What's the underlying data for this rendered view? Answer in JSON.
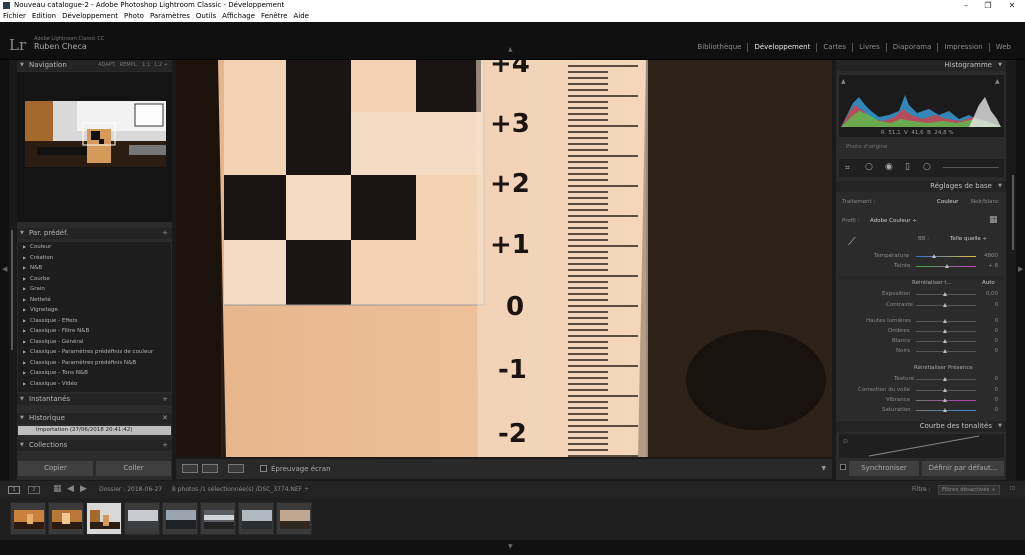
{
  "window": {
    "title": "Nouveau catalogue-2 - Adobe Photoshop Lightroom Classic - Développement"
  },
  "menu": [
    "Fichier",
    "Edition",
    "Développement",
    "Photo",
    "Paramètres",
    "Outils",
    "Affichage",
    "Fenêtre",
    "Aide"
  ],
  "identity": {
    "logo": "Lr",
    "subtitle": "Adobe Lightroom Classic CC",
    "name": "Ruben Checa"
  },
  "modules": [
    {
      "label": "Bibliothèque",
      "active": false
    },
    {
      "label": "Développement",
      "active": true
    },
    {
      "label": "Cartes",
      "active": false
    },
    {
      "label": "Livres",
      "active": false
    },
    {
      "label": "Diaporama",
      "active": false
    },
    {
      "label": "Impression",
      "active": false
    },
    {
      "label": "Web",
      "active": false
    }
  ],
  "navigator": {
    "title": "Navigation",
    "options": [
      "ADAPT.",
      "REMPL.",
      "1:1",
      "1:2 ÷"
    ]
  },
  "presets": {
    "title": "Par. prédéf.",
    "items": [
      "Couleur",
      "Création",
      "N&B",
      "Courbe",
      "Grain",
      "Netteté",
      "Vignetage",
      "Classique - Effets",
      "Classique - Filtre N&B",
      "Classique - Général",
      "Classique - Paramètres prédéfinis de couleur",
      "Classique - Paramètres prédéfinis N&B",
      "Classique - Tons N&B",
      "Classique - Vidéo"
    ]
  },
  "snapshots": {
    "title": "Instantanés"
  },
  "history": {
    "title": "Historique",
    "items": [
      "Importation (27/06/2018 20:41:42)"
    ]
  },
  "collections": {
    "title": "Collections"
  },
  "left_buttons": {
    "copy": "Copier",
    "paste": "Coller"
  },
  "toolbar": {
    "softproof": "Épreuvage écran"
  },
  "right": {
    "histogram_title": "Histogramme",
    "rgb": "R  51,1  V  41,6  B  24,8 %",
    "original_photo": "Photo d'origine",
    "basic_title": "Réglages de base",
    "treatment_label": "Traitement :",
    "treatment_color": "Couleur",
    "treatment_bw": "Noir/blanc",
    "profile_label": "Profil :",
    "profile_value": "Adobe Couleur ÷",
    "wb_label": "BB :",
    "wb_value": "Telle quelle ÷",
    "temp_label": "Température",
    "temp_value": "4800",
    "tint_label": "Teinte",
    "tint_value": "+ 8",
    "tone_label": "Réintialiser t...",
    "tone_auto": "Auto",
    "sliders1": [
      {
        "label": "Exposition",
        "value": "0,00"
      },
      {
        "label": "Contraste",
        "value": "0"
      }
    ],
    "sliders2": [
      {
        "label": "Hautes lumières",
        "value": "0"
      },
      {
        "label": "Ombres",
        "value": "0"
      },
      {
        "label": "Blancs",
        "value": "0"
      },
      {
        "label": "Noirs",
        "value": "0"
      }
    ],
    "presence_label": "Réinitialiser Présence",
    "sliders3": [
      {
        "label": "Texture",
        "value": "0"
      },
      {
        "label": "Correction du voile",
        "value": "0"
      },
      {
        "label": "Vibrance",
        "value": "0"
      },
      {
        "label": "Saturation",
        "value": "0"
      }
    ],
    "curve_title": "Courbe des tonalités",
    "sync_button": "Synchroniser",
    "defaults_button": "Définir par défaut..."
  },
  "filmbar": {
    "screen1": "1",
    "screen2": "2",
    "folder_label": "Dossier : 2018-06-27",
    "selection": "8 photos /1 sélectionnée(s) /DSC_3774.NEF ÷",
    "filter_label": "Filtre :",
    "filter_value": "Filtres désactivés ÷"
  },
  "colors": {
    "accent": "#e8e8e8",
    "panel": "#2b2b2b",
    "background": "#1a1a1a"
  }
}
